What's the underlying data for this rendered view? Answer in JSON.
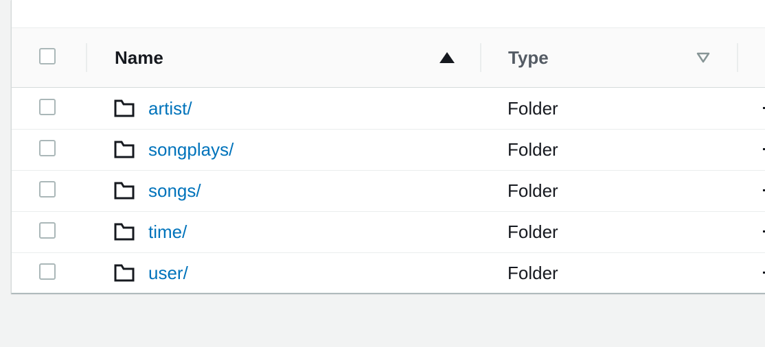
{
  "table": {
    "columns": {
      "name": "Name",
      "type": "Type"
    },
    "sort": {
      "name": "ascending",
      "type": "unsorted"
    },
    "rows": [
      {
        "name": "artist/",
        "type": "Folder",
        "icon": "folder-icon"
      },
      {
        "name": "songplays/",
        "type": "Folder",
        "icon": "folder-icon"
      },
      {
        "name": "songs/",
        "type": "Folder",
        "icon": "folder-icon"
      },
      {
        "name": "time/",
        "type": "Folder",
        "icon": "folder-icon"
      },
      {
        "name": "user/",
        "type": "Folder",
        "icon": "folder-icon"
      }
    ]
  },
  "colors": {
    "link": "#0073bb",
    "text": "#16191f",
    "border": "#aab7b8",
    "background": "#f2f3f3"
  }
}
